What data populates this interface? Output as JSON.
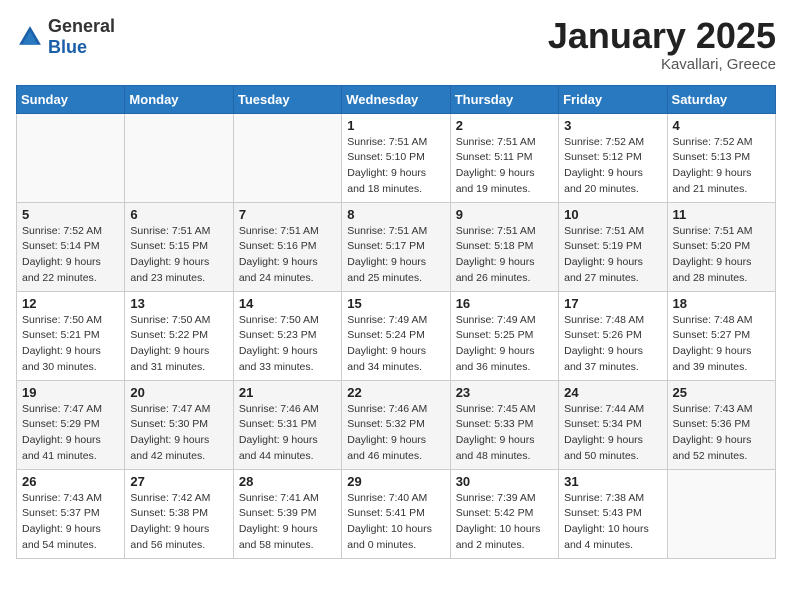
{
  "logo": {
    "text_general": "General",
    "text_blue": "Blue"
  },
  "header": {
    "month": "January 2025",
    "location": "Kavallari, Greece"
  },
  "weekdays": [
    "Sunday",
    "Monday",
    "Tuesday",
    "Wednesday",
    "Thursday",
    "Friday",
    "Saturday"
  ],
  "weeks": [
    [
      {
        "day": "",
        "info": []
      },
      {
        "day": "",
        "info": []
      },
      {
        "day": "",
        "info": []
      },
      {
        "day": "1",
        "info": [
          "Sunrise: 7:51 AM",
          "Sunset: 5:10 PM",
          "Daylight: 9 hours",
          "and 18 minutes."
        ]
      },
      {
        "day": "2",
        "info": [
          "Sunrise: 7:51 AM",
          "Sunset: 5:11 PM",
          "Daylight: 9 hours",
          "and 19 minutes."
        ]
      },
      {
        "day": "3",
        "info": [
          "Sunrise: 7:52 AM",
          "Sunset: 5:12 PM",
          "Daylight: 9 hours",
          "and 20 minutes."
        ]
      },
      {
        "day": "4",
        "info": [
          "Sunrise: 7:52 AM",
          "Sunset: 5:13 PM",
          "Daylight: 9 hours",
          "and 21 minutes."
        ]
      }
    ],
    [
      {
        "day": "5",
        "info": [
          "Sunrise: 7:52 AM",
          "Sunset: 5:14 PM",
          "Daylight: 9 hours",
          "and 22 minutes."
        ]
      },
      {
        "day": "6",
        "info": [
          "Sunrise: 7:51 AM",
          "Sunset: 5:15 PM",
          "Daylight: 9 hours",
          "and 23 minutes."
        ]
      },
      {
        "day": "7",
        "info": [
          "Sunrise: 7:51 AM",
          "Sunset: 5:16 PM",
          "Daylight: 9 hours",
          "and 24 minutes."
        ]
      },
      {
        "day": "8",
        "info": [
          "Sunrise: 7:51 AM",
          "Sunset: 5:17 PM",
          "Daylight: 9 hours",
          "and 25 minutes."
        ]
      },
      {
        "day": "9",
        "info": [
          "Sunrise: 7:51 AM",
          "Sunset: 5:18 PM",
          "Daylight: 9 hours",
          "and 26 minutes."
        ]
      },
      {
        "day": "10",
        "info": [
          "Sunrise: 7:51 AM",
          "Sunset: 5:19 PM",
          "Daylight: 9 hours",
          "and 27 minutes."
        ]
      },
      {
        "day": "11",
        "info": [
          "Sunrise: 7:51 AM",
          "Sunset: 5:20 PM",
          "Daylight: 9 hours",
          "and 28 minutes."
        ]
      }
    ],
    [
      {
        "day": "12",
        "info": [
          "Sunrise: 7:50 AM",
          "Sunset: 5:21 PM",
          "Daylight: 9 hours",
          "and 30 minutes."
        ]
      },
      {
        "day": "13",
        "info": [
          "Sunrise: 7:50 AM",
          "Sunset: 5:22 PM",
          "Daylight: 9 hours",
          "and 31 minutes."
        ]
      },
      {
        "day": "14",
        "info": [
          "Sunrise: 7:50 AM",
          "Sunset: 5:23 PM",
          "Daylight: 9 hours",
          "and 33 minutes."
        ]
      },
      {
        "day": "15",
        "info": [
          "Sunrise: 7:49 AM",
          "Sunset: 5:24 PM",
          "Daylight: 9 hours",
          "and 34 minutes."
        ]
      },
      {
        "day": "16",
        "info": [
          "Sunrise: 7:49 AM",
          "Sunset: 5:25 PM",
          "Daylight: 9 hours",
          "and 36 minutes."
        ]
      },
      {
        "day": "17",
        "info": [
          "Sunrise: 7:48 AM",
          "Sunset: 5:26 PM",
          "Daylight: 9 hours",
          "and 37 minutes."
        ]
      },
      {
        "day": "18",
        "info": [
          "Sunrise: 7:48 AM",
          "Sunset: 5:27 PM",
          "Daylight: 9 hours",
          "and 39 minutes."
        ]
      }
    ],
    [
      {
        "day": "19",
        "info": [
          "Sunrise: 7:47 AM",
          "Sunset: 5:29 PM",
          "Daylight: 9 hours",
          "and 41 minutes."
        ]
      },
      {
        "day": "20",
        "info": [
          "Sunrise: 7:47 AM",
          "Sunset: 5:30 PM",
          "Daylight: 9 hours",
          "and 42 minutes."
        ]
      },
      {
        "day": "21",
        "info": [
          "Sunrise: 7:46 AM",
          "Sunset: 5:31 PM",
          "Daylight: 9 hours",
          "and 44 minutes."
        ]
      },
      {
        "day": "22",
        "info": [
          "Sunrise: 7:46 AM",
          "Sunset: 5:32 PM",
          "Daylight: 9 hours",
          "and 46 minutes."
        ]
      },
      {
        "day": "23",
        "info": [
          "Sunrise: 7:45 AM",
          "Sunset: 5:33 PM",
          "Daylight: 9 hours",
          "and 48 minutes."
        ]
      },
      {
        "day": "24",
        "info": [
          "Sunrise: 7:44 AM",
          "Sunset: 5:34 PM",
          "Daylight: 9 hours",
          "and 50 minutes."
        ]
      },
      {
        "day": "25",
        "info": [
          "Sunrise: 7:43 AM",
          "Sunset: 5:36 PM",
          "Daylight: 9 hours",
          "and 52 minutes."
        ]
      }
    ],
    [
      {
        "day": "26",
        "info": [
          "Sunrise: 7:43 AM",
          "Sunset: 5:37 PM",
          "Daylight: 9 hours",
          "and 54 minutes."
        ]
      },
      {
        "day": "27",
        "info": [
          "Sunrise: 7:42 AM",
          "Sunset: 5:38 PM",
          "Daylight: 9 hours",
          "and 56 minutes."
        ]
      },
      {
        "day": "28",
        "info": [
          "Sunrise: 7:41 AM",
          "Sunset: 5:39 PM",
          "Daylight: 9 hours",
          "and 58 minutes."
        ]
      },
      {
        "day": "29",
        "info": [
          "Sunrise: 7:40 AM",
          "Sunset: 5:41 PM",
          "Daylight: 10 hours",
          "and 0 minutes."
        ]
      },
      {
        "day": "30",
        "info": [
          "Sunrise: 7:39 AM",
          "Sunset: 5:42 PM",
          "Daylight: 10 hours",
          "and 2 minutes."
        ]
      },
      {
        "day": "31",
        "info": [
          "Sunrise: 7:38 AM",
          "Sunset: 5:43 PM",
          "Daylight: 10 hours",
          "and 4 minutes."
        ]
      },
      {
        "day": "",
        "info": []
      }
    ]
  ]
}
